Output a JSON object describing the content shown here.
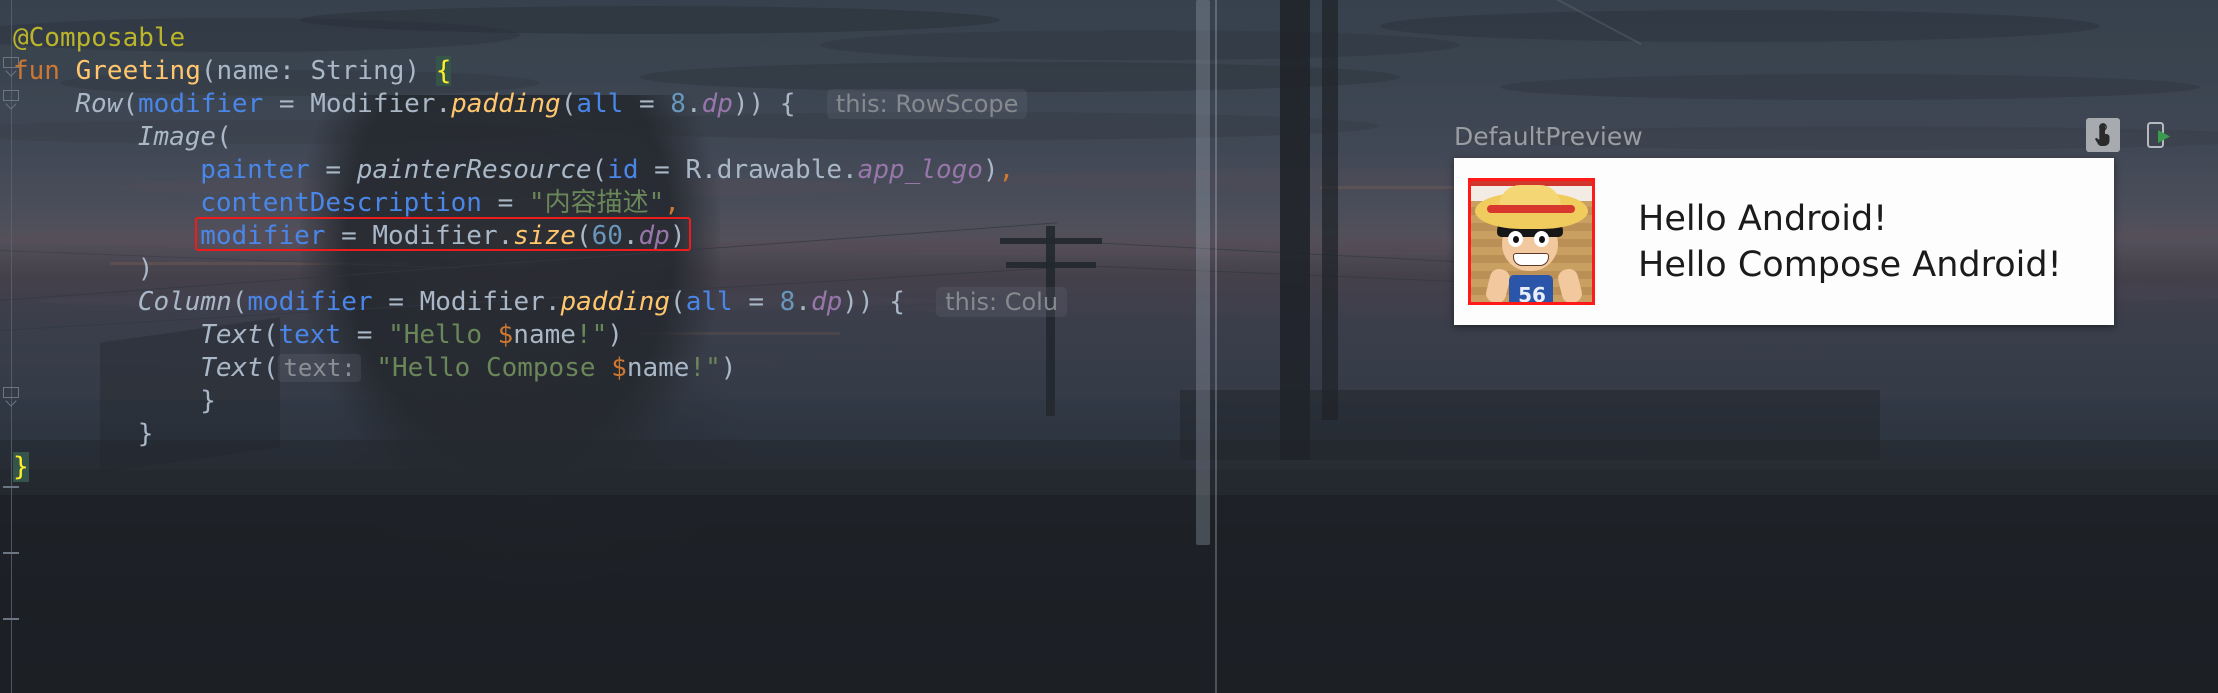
{
  "editor": {
    "language": "kotlin",
    "lines": [
      {
        "indent": 0,
        "tokens": [
          {
            "t": "@Composable",
            "c": "t-anno"
          }
        ]
      },
      {
        "indent": 0,
        "tokens": [
          {
            "t": "fun ",
            "c": "t-kw"
          },
          {
            "t": "Greeting",
            "c": "t-fn"
          },
          {
            "t": "(",
            "c": "t-punc"
          },
          {
            "t": "name",
            "c": "t-def"
          },
          {
            "t": ": ",
            "c": "t-punc"
          },
          {
            "t": "String",
            "c": "t-def"
          },
          {
            "t": ") ",
            "c": "t-punc"
          },
          {
            "t": "{",
            "c": "t-brace-hl"
          }
        ]
      },
      {
        "indent": 1,
        "tokens": [
          {
            "t": "Row",
            "c": "t-type-i"
          },
          {
            "t": "(",
            "c": "t-punc"
          },
          {
            "t": "modifier",
            "c": "t-named"
          },
          {
            "t": " = ",
            "c": "t-punc"
          },
          {
            "t": "Modifier",
            "c": "t-def"
          },
          {
            "t": ".",
            "c": "t-punc"
          },
          {
            "t": "padding",
            "c": "t-fn-i"
          },
          {
            "t": "(",
            "c": "t-punc"
          },
          {
            "t": "all",
            "c": "t-named"
          },
          {
            "t": " = ",
            "c": "t-punc"
          },
          {
            "t": "8",
            "c": "t-num"
          },
          {
            "t": ".",
            "c": "t-punc"
          },
          {
            "t": "dp",
            "c": "t-prop"
          },
          {
            "t": ")) ",
            "c": "t-punc"
          },
          {
            "t": "{",
            "c": "t-punc"
          }
        ],
        "hint": "this: RowScope"
      },
      {
        "indent": 2,
        "tokens": [
          {
            "t": "Image",
            "c": "t-type-i"
          },
          {
            "t": "(",
            "c": "t-punc"
          }
        ]
      },
      {
        "indent": 3,
        "tokens": [
          {
            "t": "painter",
            "c": "t-named"
          },
          {
            "t": " = ",
            "c": "t-punc"
          },
          {
            "t": "painterResource",
            "c": "t-type-i"
          },
          {
            "t": "(",
            "c": "t-punc"
          },
          {
            "t": "id",
            "c": "t-named"
          },
          {
            "t": " = ",
            "c": "t-punc"
          },
          {
            "t": "R.drawable.",
            "c": "t-def"
          },
          {
            "t": "app_logo",
            "c": "t-prop"
          },
          {
            "t": ")",
            "c": "t-punc"
          },
          {
            "t": ",",
            "c": "t-kw"
          }
        ]
      },
      {
        "indent": 3,
        "tokens": [
          {
            "t": "contentDescription",
            "c": "t-named"
          },
          {
            "t": " = ",
            "c": "t-punc"
          },
          {
            "t": "\"内容描述\"",
            "c": "t-str"
          },
          {
            "t": ",",
            "c": "t-kw"
          }
        ]
      },
      {
        "indent": 3,
        "boxed": true,
        "tokens": [
          {
            "t": "modifier",
            "c": "t-named"
          },
          {
            "t": " = ",
            "c": "t-punc"
          },
          {
            "t": "Modifier",
            "c": "t-def"
          },
          {
            "t": ".",
            "c": "t-punc"
          },
          {
            "t": "size",
            "c": "t-fn-i"
          },
          {
            "t": "(",
            "c": "t-punc"
          },
          {
            "t": "60",
            "c": "t-num"
          },
          {
            "t": ".",
            "c": "t-punc"
          },
          {
            "t": "dp",
            "c": "t-prop"
          },
          {
            "t": ")",
            "c": "t-punc"
          }
        ]
      },
      {
        "indent": 2,
        "tokens": [
          {
            "t": ")",
            "c": "t-punc"
          }
        ]
      },
      {
        "indent": 2,
        "tokens": [
          {
            "t": "Column",
            "c": "t-type-i"
          },
          {
            "t": "(",
            "c": "t-punc"
          },
          {
            "t": "modifier",
            "c": "t-named"
          },
          {
            "t": " = ",
            "c": "t-punc"
          },
          {
            "t": "Modifier",
            "c": "t-def"
          },
          {
            "t": ".",
            "c": "t-punc"
          },
          {
            "t": "padding",
            "c": "t-fn-i"
          },
          {
            "t": "(",
            "c": "t-punc"
          },
          {
            "t": "all",
            "c": "t-named"
          },
          {
            "t": " = ",
            "c": "t-punc"
          },
          {
            "t": "8",
            "c": "t-num"
          },
          {
            "t": ".",
            "c": "t-punc"
          },
          {
            "t": "dp",
            "c": "t-prop"
          },
          {
            "t": ")) ",
            "c": "t-punc"
          },
          {
            "t": "{",
            "c": "t-punc"
          }
        ],
        "hint": "this: Colu"
      },
      {
        "indent": 3,
        "tokens": [
          {
            "t": "Text",
            "c": "t-type-i"
          },
          {
            "t": "(",
            "c": "t-punc"
          },
          {
            "t": "text",
            "c": "t-named"
          },
          {
            "t": " = ",
            "c": "t-punc"
          },
          {
            "t": "\"Hello ",
            "c": "t-str"
          },
          {
            "t": "$",
            "c": "t-tmpl"
          },
          {
            "t": "name",
            "c": "t-def"
          },
          {
            "t": "!\"",
            "c": "t-str"
          },
          {
            "t": ")",
            "c": "t-punc"
          }
        ]
      },
      {
        "indent": 3,
        "tokens": [
          {
            "t": "Text",
            "c": "t-type-i"
          },
          {
            "t": "(",
            "c": "t-punc"
          }
        ],
        "inlay": "text:",
        "after": [
          {
            "t": "\"Hello Compose ",
            "c": "t-str"
          },
          {
            "t": "$",
            "c": "t-tmpl"
          },
          {
            "t": "name",
            "c": "t-def"
          },
          {
            "t": "!\"",
            "c": "t-str"
          },
          {
            "t": ")",
            "c": "t-punc"
          }
        ]
      },
      {
        "indent": 3,
        "tokens": [
          {
            "t": "}",
            "c": "t-punc"
          }
        ]
      },
      {
        "indent": 2,
        "tokens": [
          {
            "t": "}",
            "c": "t-punc"
          }
        ]
      },
      {
        "indent": 0,
        "tokens": [
          {
            "t": "}",
            "c": "t-brace-hl"
          }
        ]
      }
    ],
    "gutter": {
      "fold_markers": [
        "fold",
        "fold",
        "fold",
        "bar",
        "bar",
        "bar"
      ]
    },
    "scrollbar": {
      "name": "vertical-scrollbar"
    }
  },
  "preview": {
    "label": "DefaultPreview",
    "tools": [
      {
        "name": "interactive-mode-icon",
        "glyph": "touch"
      },
      {
        "name": "run-on-device-icon",
        "glyph": "device-play"
      }
    ],
    "card": {
      "image_alt": "app_logo",
      "texts": [
        "Hello Android!",
        "Hello Compose Android!"
      ],
      "avatar_number": "56"
    }
  },
  "colors": {
    "annotation": "#bbb529",
    "keyword": "#cc7832",
    "function": "#ffc66d",
    "named_arg": "#4a86e8",
    "string": "#6a8759",
    "number": "#6897bb",
    "property": "#9876aa",
    "default_text": "#a9b7c6",
    "highlight_box": "#ee1c1c",
    "brace_highlight_bg": "#35554a",
    "brace_highlight_fg": "#ffef28",
    "run_icon_green": "#3a9b4e"
  }
}
